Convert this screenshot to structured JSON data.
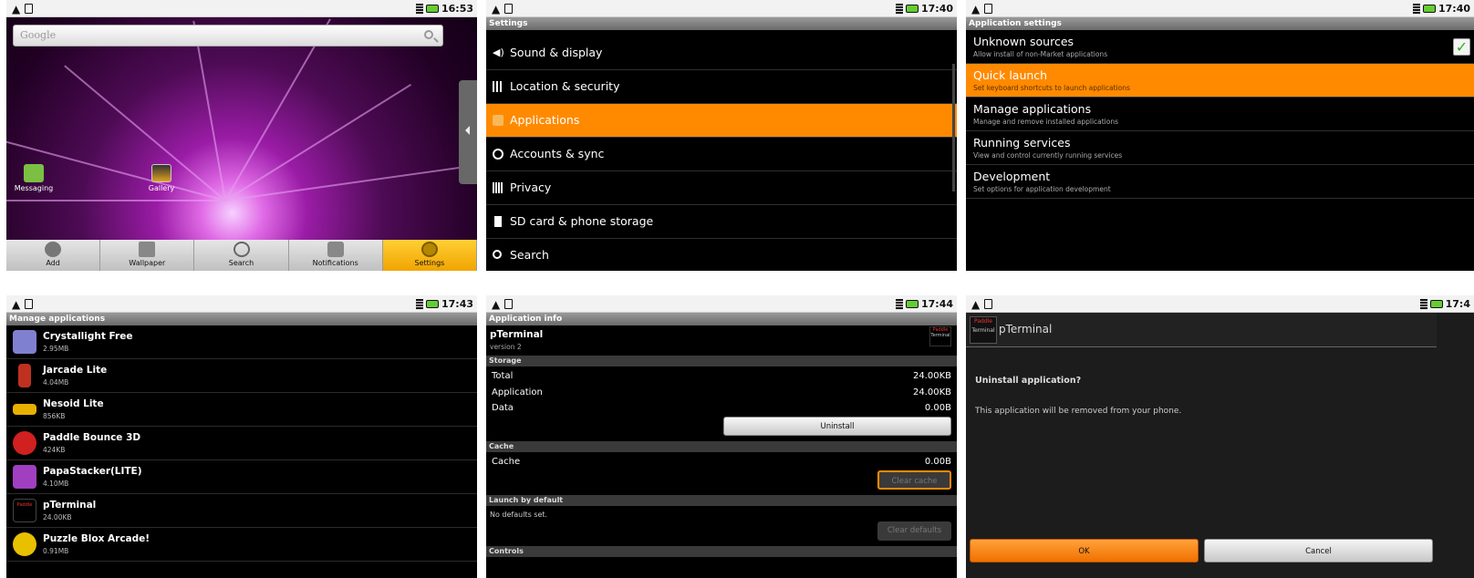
{
  "statusbars": {
    "p1": {
      "time": "16:53"
    },
    "p2": {
      "time": "17:40"
    },
    "p3": {
      "time": "17:40"
    },
    "p4": {
      "time": "17:43"
    },
    "p5": {
      "time": "17:44"
    },
    "p6": {
      "time": "17:4"
    }
  },
  "home": {
    "search_placeholder": "Google",
    "icons": [
      {
        "label": "Messaging",
        "icon": "messaging-icon"
      },
      {
        "label": "Gallery",
        "icon": "gallery-icon"
      }
    ],
    "dock": [
      {
        "label": "Add",
        "icon": "add-icon"
      },
      {
        "label": "Wallpaper",
        "icon": "wallpaper-icon"
      },
      {
        "label": "Search",
        "icon": "search-icon"
      },
      {
        "label": "Notifications",
        "icon": "notifications-icon"
      },
      {
        "label": "Settings",
        "icon": "settings-icon"
      }
    ],
    "colors": {
      "accent": "#ffb000"
    }
  },
  "settings": {
    "title": "Settings",
    "items": [
      {
        "label": "Sound & display",
        "icon": "speaker-icon"
      },
      {
        "label": "Location & security",
        "icon": "grid-icon"
      },
      {
        "label": "Applications",
        "icon": "applications-icon"
      },
      {
        "label": "Accounts & sync",
        "icon": "sync-icon"
      },
      {
        "label": "Privacy",
        "icon": "privacy-icon"
      },
      {
        "label": "SD card & phone storage",
        "icon": "sdcard-icon"
      },
      {
        "label": "Search",
        "icon": "search-icon"
      }
    ],
    "colors": {
      "selected": "#ff8a00"
    }
  },
  "app_settings": {
    "title": "Application settings",
    "items": [
      {
        "title": "Unknown sources",
        "subtitle": "Allow install of non-Market applications",
        "checked": true
      },
      {
        "title": "Quick launch",
        "subtitle": "Set keyboard shortcuts to launch applications"
      },
      {
        "title": "Manage applications",
        "subtitle": "Manage and remove installed applications"
      },
      {
        "title": "Running services",
        "subtitle": "View and control currently running services"
      },
      {
        "title": "Development",
        "subtitle": "Set options for application development"
      }
    ]
  },
  "manage_apps": {
    "title": "Manage applications",
    "apps": [
      {
        "name": "Crystallight Free",
        "size": "2.95MB",
        "icon": "crystallight-icon",
        "color": "#8080d0"
      },
      {
        "name": "Jarcade Lite",
        "size": "4.04MB",
        "icon": "jarcade-icon",
        "color": "#c03020"
      },
      {
        "name": "Nesoid Lite",
        "size": "856KB",
        "icon": "nesoid-icon",
        "color": "#e8b000"
      },
      {
        "name": "Paddle Bounce 3D",
        "size": "424KB",
        "icon": "paddle-icon",
        "color": "#d02020"
      },
      {
        "name": "PapaStacker(LITE)",
        "size": "4.10MB",
        "icon": "papastacker-icon",
        "color": "#a040c0"
      },
      {
        "name": "pTerminal",
        "size": "24.00KB",
        "icon": "pterminal-icon",
        "color": "#222"
      },
      {
        "name": "Puzzle Blox Arcade!",
        "size": "0.91MB",
        "icon": "puzzleblox-icon",
        "color": "#e8c000"
      }
    ]
  },
  "app_info": {
    "title": "Application info",
    "app_name": "pTerminal",
    "version": "version 2",
    "storage_header": "Storage",
    "storage": [
      {
        "label": "Total",
        "value": "24.00KB"
      },
      {
        "label": "Application",
        "value": "24.00KB"
      },
      {
        "label": "Data",
        "value": "0.00B"
      }
    ],
    "uninstall_label": "Uninstall",
    "cache_header": "Cache",
    "cache": {
      "label": "Cache",
      "value": "0.00B"
    },
    "clear_cache_label": "Clear cache",
    "launch_header": "Launch by default",
    "launch_text": "No defaults set.",
    "clear_defaults_label": "Clear defaults",
    "controls_header": "Controls"
  },
  "uninstall_dialog": {
    "app_name": "pTerminal",
    "question": "Uninstall application?",
    "message": "This application will be removed from your phone.",
    "ok_label": "OK",
    "cancel_label": "Cancel"
  },
  "logo_text": {
    "paddle": "Paddle",
    "terminal": "Terminal"
  }
}
